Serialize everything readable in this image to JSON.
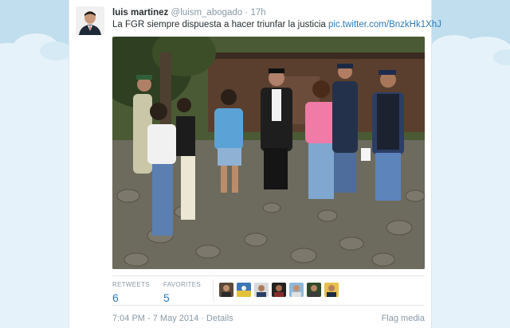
{
  "tweet": {
    "name": "luis martinez",
    "handle": "@luism_abogado",
    "separator": "·",
    "time": "17h",
    "text": "La FGR siempre dispuesta a hacer triunfar la justicia",
    "link": "pic.twitter.com/BnzkHk1XhJ"
  },
  "stats": {
    "retweets_label": "RETWEETS",
    "retweets_count": "6",
    "favorites_label": "FAVORITES",
    "favorites_count": "5"
  },
  "footer": {
    "timestamp": "7:04 PM - 7 May 2014",
    "separator": "·",
    "details": "Details",
    "flag": "Flag media"
  },
  "colors": {
    "background": "#c0deed",
    "link": "#2b7bb9",
    "muted": "#8899a6"
  }
}
